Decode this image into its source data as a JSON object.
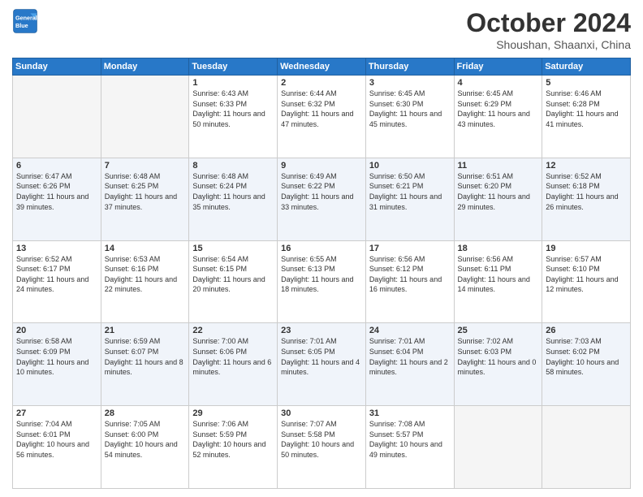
{
  "header": {
    "logo_general": "General",
    "logo_blue": "Blue",
    "title": "October 2024",
    "subtitle": "Shoushan, Shaanxi, China"
  },
  "weekdays": [
    "Sunday",
    "Monday",
    "Tuesday",
    "Wednesday",
    "Thursday",
    "Friday",
    "Saturday"
  ],
  "weeks": [
    [
      {
        "day": "",
        "empty": true
      },
      {
        "day": "",
        "empty": true
      },
      {
        "day": "1",
        "sunrise": "6:43 AM",
        "sunset": "6:33 PM",
        "daylight": "11 hours and 50 minutes."
      },
      {
        "day": "2",
        "sunrise": "6:44 AM",
        "sunset": "6:32 PM",
        "daylight": "11 hours and 47 minutes."
      },
      {
        "day": "3",
        "sunrise": "6:45 AM",
        "sunset": "6:30 PM",
        "daylight": "11 hours and 45 minutes."
      },
      {
        "day": "4",
        "sunrise": "6:45 AM",
        "sunset": "6:29 PM",
        "daylight": "11 hours and 43 minutes."
      },
      {
        "day": "5",
        "sunrise": "6:46 AM",
        "sunset": "6:28 PM",
        "daylight": "11 hours and 41 minutes."
      }
    ],
    [
      {
        "day": "6",
        "sunrise": "6:47 AM",
        "sunset": "6:26 PM",
        "daylight": "11 hours and 39 minutes."
      },
      {
        "day": "7",
        "sunrise": "6:48 AM",
        "sunset": "6:25 PM",
        "daylight": "11 hours and 37 minutes."
      },
      {
        "day": "8",
        "sunrise": "6:48 AM",
        "sunset": "6:24 PM",
        "daylight": "11 hours and 35 minutes."
      },
      {
        "day": "9",
        "sunrise": "6:49 AM",
        "sunset": "6:22 PM",
        "daylight": "11 hours and 33 minutes."
      },
      {
        "day": "10",
        "sunrise": "6:50 AM",
        "sunset": "6:21 PM",
        "daylight": "11 hours and 31 minutes."
      },
      {
        "day": "11",
        "sunrise": "6:51 AM",
        "sunset": "6:20 PM",
        "daylight": "11 hours and 29 minutes."
      },
      {
        "day": "12",
        "sunrise": "6:52 AM",
        "sunset": "6:18 PM",
        "daylight": "11 hours and 26 minutes."
      }
    ],
    [
      {
        "day": "13",
        "sunrise": "6:52 AM",
        "sunset": "6:17 PM",
        "daylight": "11 hours and 24 minutes."
      },
      {
        "day": "14",
        "sunrise": "6:53 AM",
        "sunset": "6:16 PM",
        "daylight": "11 hours and 22 minutes."
      },
      {
        "day": "15",
        "sunrise": "6:54 AM",
        "sunset": "6:15 PM",
        "daylight": "11 hours and 20 minutes."
      },
      {
        "day": "16",
        "sunrise": "6:55 AM",
        "sunset": "6:13 PM",
        "daylight": "11 hours and 18 minutes."
      },
      {
        "day": "17",
        "sunrise": "6:56 AM",
        "sunset": "6:12 PM",
        "daylight": "11 hours and 16 minutes."
      },
      {
        "day": "18",
        "sunrise": "6:56 AM",
        "sunset": "6:11 PM",
        "daylight": "11 hours and 14 minutes."
      },
      {
        "day": "19",
        "sunrise": "6:57 AM",
        "sunset": "6:10 PM",
        "daylight": "11 hours and 12 minutes."
      }
    ],
    [
      {
        "day": "20",
        "sunrise": "6:58 AM",
        "sunset": "6:09 PM",
        "daylight": "11 hours and 10 minutes."
      },
      {
        "day": "21",
        "sunrise": "6:59 AM",
        "sunset": "6:07 PM",
        "daylight": "11 hours and 8 minutes."
      },
      {
        "day": "22",
        "sunrise": "7:00 AM",
        "sunset": "6:06 PM",
        "daylight": "11 hours and 6 minutes."
      },
      {
        "day": "23",
        "sunrise": "7:01 AM",
        "sunset": "6:05 PM",
        "daylight": "11 hours and 4 minutes."
      },
      {
        "day": "24",
        "sunrise": "7:01 AM",
        "sunset": "6:04 PM",
        "daylight": "11 hours and 2 minutes."
      },
      {
        "day": "25",
        "sunrise": "7:02 AM",
        "sunset": "6:03 PM",
        "daylight": "11 hours and 0 minutes."
      },
      {
        "day": "26",
        "sunrise": "7:03 AM",
        "sunset": "6:02 PM",
        "daylight": "10 hours and 58 minutes."
      }
    ],
    [
      {
        "day": "27",
        "sunrise": "7:04 AM",
        "sunset": "6:01 PM",
        "daylight": "10 hours and 56 minutes."
      },
      {
        "day": "28",
        "sunrise": "7:05 AM",
        "sunset": "6:00 PM",
        "daylight": "10 hours and 54 minutes."
      },
      {
        "day": "29",
        "sunrise": "7:06 AM",
        "sunset": "5:59 PM",
        "daylight": "10 hours and 52 minutes."
      },
      {
        "day": "30",
        "sunrise": "7:07 AM",
        "sunset": "5:58 PM",
        "daylight": "10 hours and 50 minutes."
      },
      {
        "day": "31",
        "sunrise": "7:08 AM",
        "sunset": "5:57 PM",
        "daylight": "10 hours and 49 minutes."
      },
      {
        "day": "",
        "empty": true
      },
      {
        "day": "",
        "empty": true
      }
    ]
  ]
}
